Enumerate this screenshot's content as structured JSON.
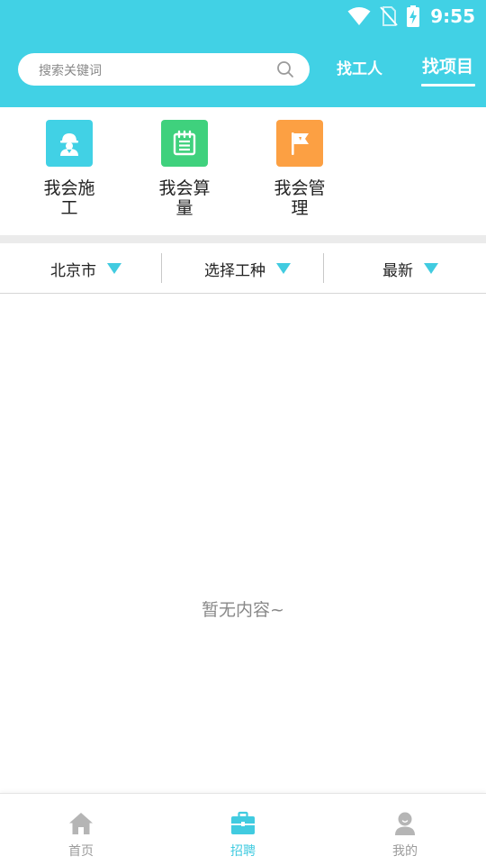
{
  "status_bar": {
    "time": "9:55",
    "icons": [
      "wifi-icon",
      "no-sim-icon",
      "battery-charging-icon"
    ]
  },
  "header": {
    "search": {
      "placeholder": "搜索关键词",
      "icon": "search-icon"
    },
    "tabs": [
      {
        "label": "找工人",
        "active": false
      },
      {
        "label": "找项目",
        "active": true
      }
    ],
    "color": "#41d1e5"
  },
  "categories": [
    {
      "label": "我会施工",
      "icon": "worker-icon",
      "color": "#41d1e5"
    },
    {
      "label": "我会算量",
      "icon": "notepad-icon",
      "color": "#3fd17d"
    },
    {
      "label": "我会管理",
      "icon": "flag-icon",
      "color": "#fca043"
    }
  ],
  "filters": [
    {
      "label": "北京市",
      "icon": "triangle-down-icon"
    },
    {
      "label": "选择工种",
      "icon": "triangle-down-icon"
    },
    {
      "label": "最新",
      "icon": "triangle-down-icon"
    }
  ],
  "empty_state": {
    "text": "暂无内容~"
  },
  "bottom_nav": [
    {
      "label": "首页",
      "icon": "home-icon",
      "active": false
    },
    {
      "label": "招聘",
      "icon": "briefcase-icon",
      "active": true
    },
    {
      "label": "我的",
      "icon": "user-icon",
      "active": false
    }
  ],
  "colors": {
    "accent": "#41d1e5",
    "inactive": "#9b9b9b",
    "filter_triangle": "#41cbe0"
  }
}
